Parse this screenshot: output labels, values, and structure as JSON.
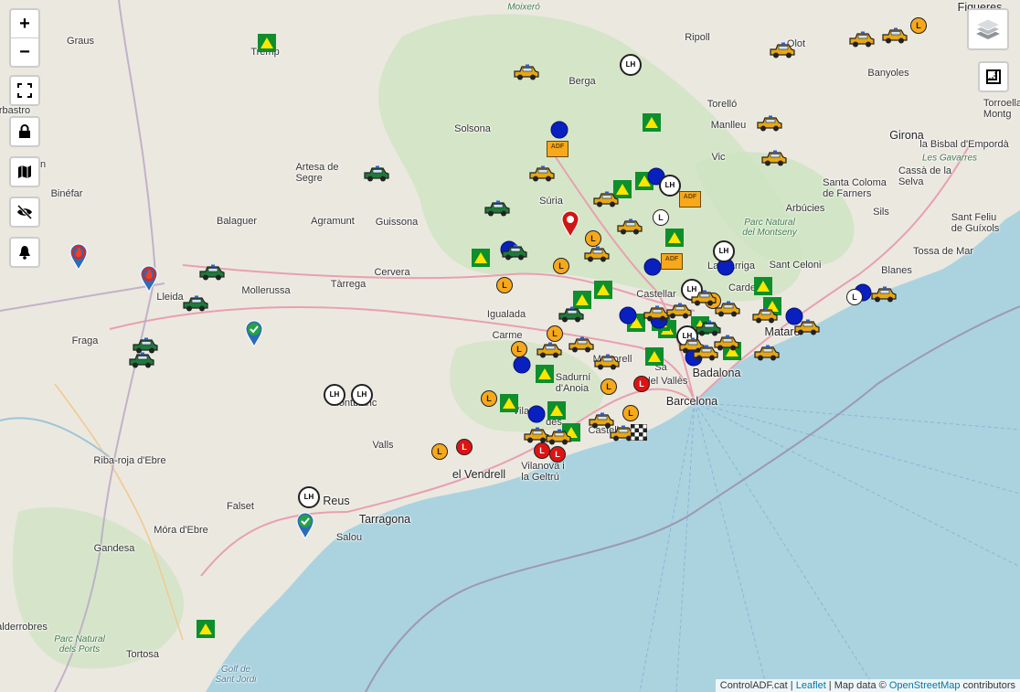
{
  "map": {
    "colors": {
      "sea": "#aad3df",
      "land": "#ebe8e0",
      "forest": "#cde4c0",
      "road": "#e8a0b0",
      "border": "#9b8aa8"
    },
    "places": [
      {
        "id": "moixero",
        "name": "Moixeró",
        "style": "moixero"
      },
      {
        "id": "graus",
        "name": "Graus"
      },
      {
        "id": "tremp",
        "name": "Tremp"
      },
      {
        "id": "figueres",
        "name": "Figueres",
        "style": "big"
      },
      {
        "id": "ripoll",
        "name": "Ripoll"
      },
      {
        "id": "olot",
        "name": "Olot"
      },
      {
        "id": "berga",
        "name": "Berga"
      },
      {
        "id": "banyoles",
        "name": "Banyoles"
      },
      {
        "id": "barbastro",
        "name": "rbastro"
      },
      {
        "id": "torroella",
        "name": "Torroella\nMontg"
      },
      {
        "id": "torello",
        "name": "Torelló"
      },
      {
        "id": "manlleu",
        "name": "Manlleu"
      },
      {
        "id": "solsona",
        "name": "Solsona"
      },
      {
        "id": "girona",
        "name": "Girona",
        "style": "big"
      },
      {
        "id": "bisbal",
        "name": "la Bisbal d'Empordà"
      },
      {
        "id": "vic",
        "name": "Vic"
      },
      {
        "id": "monzon",
        "name": "ón"
      },
      {
        "id": "gavarres",
        "name": "Les Gavarres",
        "style": "park"
      },
      {
        "id": "cassa",
        "name": "Cassà de la\nSelva"
      },
      {
        "id": "artesa",
        "name": "Artesa de\nSegre"
      },
      {
        "id": "binefar",
        "name": "Binéfar"
      },
      {
        "id": "suria",
        "name": "Súria"
      },
      {
        "id": "arbucies",
        "name": "Arbúcies"
      },
      {
        "id": "santacoloma",
        "name": "Santa Coloma\nde Farners"
      },
      {
        "id": "balaguer",
        "name": "Balaguer"
      },
      {
        "id": "agramunt",
        "name": "Agramunt"
      },
      {
        "id": "guissona",
        "name": "Guissona"
      },
      {
        "id": "montseny",
        "name": "Parc Natural\ndel Montseny",
        "style": "park"
      },
      {
        "id": "sils",
        "name": "Sils"
      },
      {
        "id": "santfeliu",
        "name": "Sant Feliu\nde Guíxols"
      },
      {
        "id": "tossa",
        "name": "Tossa de Mar"
      },
      {
        "id": "santceloni",
        "name": "Sant Celoni"
      },
      {
        "id": "cervera",
        "name": "Cervera"
      },
      {
        "id": "blanes",
        "name": "Blanes"
      },
      {
        "id": "lagarriga",
        "name": "La Garriga"
      },
      {
        "id": "mollerussa",
        "name": "Mollerussa"
      },
      {
        "id": "tarrega",
        "name": "Tàrrega"
      },
      {
        "id": "lleida",
        "name": "Lleida"
      },
      {
        "id": "igualada",
        "name": "Igualada"
      },
      {
        "id": "cardedeu",
        "name": "Carde"
      },
      {
        "id": "castellar",
        "name": "Castellar"
      },
      {
        "id": "terrassa",
        "name": "Te"
      },
      {
        "id": "mataro",
        "name": "Mataró",
        "style": "big"
      },
      {
        "id": "fraga",
        "name": "Fraga"
      },
      {
        "id": "carme",
        "name": "Carme"
      },
      {
        "id": "martorell",
        "name": "Martorell"
      },
      {
        "id": "badalona",
        "name": "Badalona",
        "style": "big"
      },
      {
        "id": "sadurni",
        "name": "Sadurní\nd'Anoia"
      },
      {
        "id": "cerdanyola",
        "name": "del Vallès"
      },
      {
        "id": "sabadell",
        "name": "Sa"
      },
      {
        "id": "montblanc",
        "name": "Montblanc"
      },
      {
        "id": "barcelona",
        "name": "Barcelona",
        "style": "big"
      },
      {
        "id": "vilafranca",
        "name": "Vila"
      },
      {
        "id": "penedes",
        "name": "dès"
      },
      {
        "id": "castelldefels",
        "name": "Castelldefels"
      },
      {
        "id": "valls",
        "name": "Valls"
      },
      {
        "id": "ribaroja",
        "name": "Riba-roja d'Ebre"
      },
      {
        "id": "vendrell",
        "name": "el Vendrell",
        "style": "big"
      },
      {
        "id": "vilanova",
        "name": "Vilanova i\nla Geltrú"
      },
      {
        "id": "falset",
        "name": "Falset"
      },
      {
        "id": "reus",
        "name": "Reus",
        "style": "big"
      },
      {
        "id": "tarragona",
        "name": "Tarragona",
        "style": "big"
      },
      {
        "id": "moradebre",
        "name": "Móra d'Ebre"
      },
      {
        "id": "salou",
        "name": "Salou"
      },
      {
        "id": "gandesa",
        "name": "Gandesa"
      },
      {
        "id": "alderrobres",
        "name": "alderrobres"
      },
      {
        "id": "ports",
        "name": "Parc Natural\ndels Ports",
        "style": "park"
      },
      {
        "id": "golf",
        "name": "Golf de\nSant Jordi",
        "style": "geo"
      },
      {
        "id": "tortosa",
        "name": "Tortosa"
      }
    ]
  },
  "controls": {
    "zoom_in": "+",
    "zoom_out": "−",
    "icons": [
      "fullscreen-icon",
      "lock-icon",
      "map-icon",
      "eye-off-icon",
      "bell-icon",
      "layers-icon",
      "ruler-icon"
    ]
  },
  "attribution": {
    "site": "ControlADF.cat",
    "sep1": " | ",
    "leaflet": "Leaflet",
    "sep2": " | Map data © ",
    "osm": "OpenStreetMap",
    "tail": " contributors"
  },
  "marker_labels": {
    "lh": "LH",
    "adf": "ADF",
    "c": "L"
  },
  "markers": [
    {
      "t": "tri"
    },
    {
      "t": "tri"
    },
    {
      "t": "tri"
    },
    {
      "t": "tri"
    },
    {
      "t": "tri"
    },
    {
      "t": "tri"
    },
    {
      "t": "tri"
    },
    {
      "t": "tri"
    },
    {
      "t": "tri"
    },
    {
      "t": "tri"
    },
    {
      "t": "tri"
    },
    {
      "t": "tri"
    },
    {
      "t": "tri"
    },
    {
      "t": "tri"
    },
    {
      "t": "tri"
    },
    {
      "t": "tri"
    },
    {
      "t": "tri"
    },
    {
      "t": "tri"
    },
    {
      "t": "tri"
    },
    {
      "t": "tri"
    },
    {
      "t": "tri"
    },
    {
      "t": "dotb"
    },
    {
      "t": "dotb"
    },
    {
      "t": "dotb"
    },
    {
      "t": "dotb"
    },
    {
      "t": "dotb"
    },
    {
      "t": "dotb"
    },
    {
      "t": "dotb"
    },
    {
      "t": "dotb"
    },
    {
      "t": "dotb"
    },
    {
      "t": "dotb"
    },
    {
      "t": "dotb"
    },
    {
      "t": "dotb"
    },
    {
      "t": "co"
    },
    {
      "t": "co"
    },
    {
      "t": "co"
    },
    {
      "t": "co"
    },
    {
      "t": "co"
    },
    {
      "t": "co"
    },
    {
      "t": "co"
    },
    {
      "t": "co"
    },
    {
      "t": "co"
    },
    {
      "t": "co"
    },
    {
      "t": "co"
    },
    {
      "t": "cr"
    },
    {
      "t": "cr"
    },
    {
      "t": "cr"
    },
    {
      "t": "cr"
    },
    {
      "t": "cw"
    },
    {
      "t": "cw"
    },
    {
      "t": "lh"
    },
    {
      "t": "lh"
    },
    {
      "t": "lh"
    },
    {
      "t": "lh"
    },
    {
      "t": "lh"
    },
    {
      "t": "lh"
    },
    {
      "t": "lh"
    },
    {
      "t": "lh"
    },
    {
      "t": "adf"
    },
    {
      "t": "adf"
    },
    {
      "t": "adf"
    },
    {
      "t": "pinfire"
    },
    {
      "t": "pinfire"
    },
    {
      "t": "pincheck"
    },
    {
      "t": "pincheck"
    },
    {
      "t": "pinred"
    },
    {
      "t": "vg"
    },
    {
      "t": "vg"
    },
    {
      "t": "vg"
    },
    {
      "t": "vg"
    },
    {
      "t": "vg"
    },
    {
      "t": "vg"
    },
    {
      "t": "vg"
    },
    {
      "t": "vg"
    },
    {
      "t": "vg"
    },
    {
      "t": "vy"
    },
    {
      "t": "vy"
    },
    {
      "t": "vy"
    },
    {
      "t": "vy"
    },
    {
      "t": "vy"
    },
    {
      "t": "vy"
    },
    {
      "t": "vy"
    },
    {
      "t": "vy"
    },
    {
      "t": "vy"
    },
    {
      "t": "vy"
    },
    {
      "t": "vy"
    },
    {
      "t": "vy"
    },
    {
      "t": "vy"
    },
    {
      "t": "vy"
    },
    {
      "t": "vy"
    },
    {
      "t": "vy"
    },
    {
      "t": "vy"
    },
    {
      "t": "vy"
    },
    {
      "t": "vy"
    },
    {
      "t": "vy"
    },
    {
      "t": "vy"
    },
    {
      "t": "vy"
    },
    {
      "t": "vy"
    },
    {
      "t": "vy"
    },
    {
      "t": "vy"
    },
    {
      "t": "vy"
    },
    {
      "t": "vy"
    },
    {
      "t": "vy"
    },
    {
      "t": "chk"
    }
  ]
}
